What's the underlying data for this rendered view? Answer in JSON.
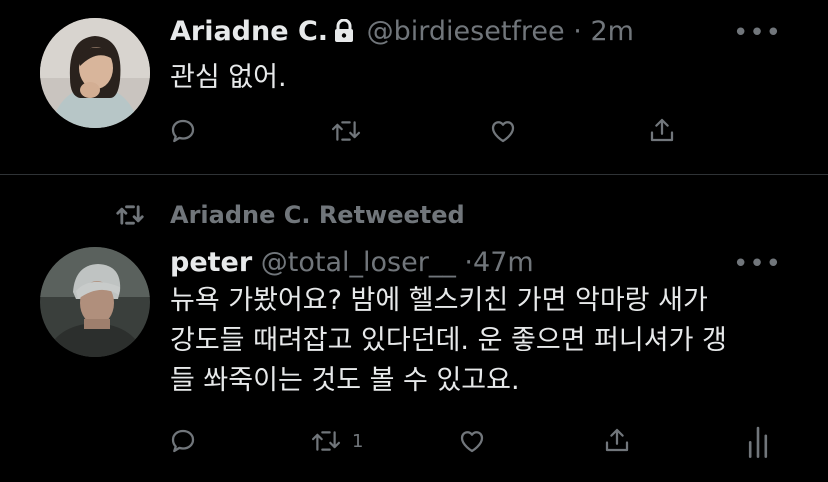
{
  "tweets": [
    {
      "author": {
        "name": "Ariadne C.",
        "handle": "@birdiesetfree",
        "protected": true
      },
      "separator": "·",
      "time": "2m",
      "lines": [
        "관심 없어."
      ],
      "more_glyph": "•••",
      "actions": [
        "reply",
        "retweet",
        "like",
        "share"
      ]
    },
    {
      "retweeted_by": "Ariadne C. Retweeted",
      "author": {
        "name": "peter",
        "handle": "@total_loser__"
      },
      "separator": "·",
      "time": "47m",
      "lines": [
        "뉴욕 가봤어요? 밤에 헬스키친 가면 악마랑 새가",
        "강도들 때려잡고 있다던데. 운 좋으면 퍼니셔가 갱",
        "들 쏴죽이는 것도 볼 수 있고요."
      ],
      "more_glyph": "•••",
      "retweet_count": "1",
      "actions": [
        "reply",
        "retweet",
        "like",
        "share",
        "analytics"
      ]
    }
  ],
  "colors": {
    "background": "#000000",
    "text": "#e7e9ea",
    "muted": "#71767b",
    "divider": "#2f3336"
  }
}
